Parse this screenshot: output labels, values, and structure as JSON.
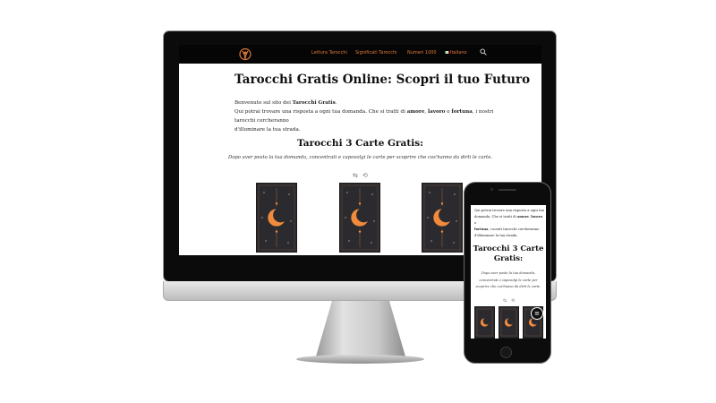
{
  "nav": {
    "items": [
      "Lettura Tarocchi",
      "Significati Tarocchi",
      "Numeri 1000",
      "Italiano"
    ],
    "icons": [
      "tarot-logo-icon",
      "italian-flag-icon",
      "search-icon"
    ]
  },
  "desktop": {
    "title": "Tarocchi Gratis Online: Scopri il tuo Futuro",
    "intro": {
      "line1_prefix": "Benvenuto sul sito dei ",
      "line1_bold": "Tarocchi Gratis",
      "line1_suffix": ".",
      "line2_a": "Qui potrai trovare una risposta a ogni tua domanda. Che si tratti di ",
      "bold_love": "amore",
      "sep1": ", ",
      "bold_work": "lavoro",
      "sep2": " o ",
      "bold_fortune": "fortuna",
      "line2_b": ", i nostri tarocchi cercheranno",
      "line3": "d'illuminare la tua strada."
    },
    "section_title": "Tarocchi 3 Carte Gratis:",
    "instructions": "Dopo aver posto la tua domanda, concentrati e capovolgi le carte per scoprire che cos'hanno da dirti le carte.",
    "controls": [
      "⇆",
      "⟲"
    ]
  },
  "mobile": {
    "intro": {
      "line1": "Qui potrai trovare una risposta a ogni tua",
      "line2_a": "domanda. Che si tratti di ",
      "bold_love": "amore",
      "sep1": ", ",
      "bold_work": "lavoro",
      "sep2": " o",
      "bold_fortune": "fortuna",
      "line3_b": ", i nostri tarocchi cercheranno",
      "line4": "d'illuminare la tua strada."
    },
    "section_title_line1": "Tarocchi 3 Carte",
    "section_title_line2": "Gratis:",
    "instructions": "Dopo aver posto la tua domanda, concentrati e capovolgi le carte per scoprire che cos'hanno da dirti le carte.",
    "controls": [
      "⇆",
      "⟲"
    ],
    "menu_button": "≡"
  },
  "colors": {
    "accent": "#e07a3a",
    "card_back": "#2b2b2f",
    "moon": "#f28a3c",
    "nav_bg": "#050505"
  }
}
